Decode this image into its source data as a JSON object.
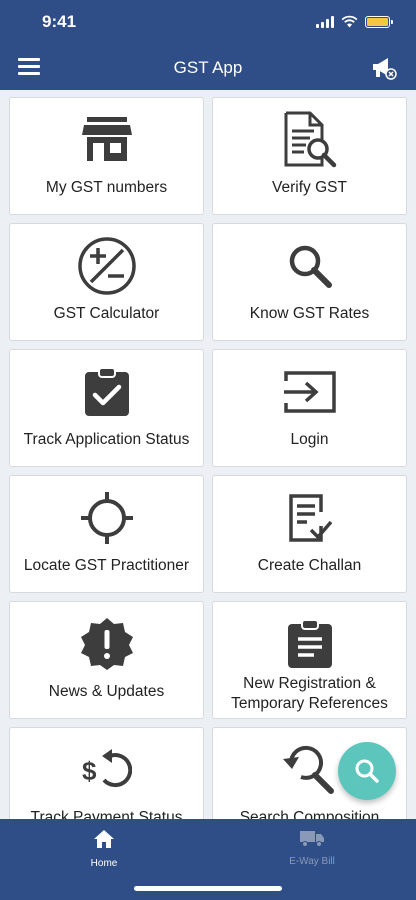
{
  "status": {
    "time": "9:41"
  },
  "header": {
    "title": "GST App"
  },
  "tiles": [
    {
      "label": "My GST numbers",
      "icon": "store-icon"
    },
    {
      "label": "Verify GST",
      "icon": "document-search-icon"
    },
    {
      "label": "GST Calculator",
      "icon": "plus-minus-icon"
    },
    {
      "label": "Know GST Rates",
      "icon": "search-icon"
    },
    {
      "label": "Track Application Status",
      "icon": "clipboard-check-icon"
    },
    {
      "label": "Login",
      "icon": "login-icon"
    },
    {
      "label": "Locate GST Practitioner",
      "icon": "crosshair-icon"
    },
    {
      "label": "Create Challan",
      "icon": "document-edit-icon"
    },
    {
      "label": "News & Updates",
      "icon": "alert-badge-icon"
    },
    {
      "label": "New Registration & Temporary References",
      "icon": "clipboard-list-icon"
    },
    {
      "label": "Track Payment Status",
      "icon": "dollar-refresh-icon"
    },
    {
      "label": "Search Composition",
      "icon": "search-history-icon"
    }
  ],
  "bottom_nav": [
    {
      "label": "Home",
      "icon": "home-icon",
      "active": true
    },
    {
      "label": "E-Way Bill",
      "icon": "truck-icon",
      "active": false
    }
  ],
  "colors": {
    "primary": "#2f4d86",
    "accent": "#5cc6bd",
    "icon": "#3d3d3d"
  }
}
